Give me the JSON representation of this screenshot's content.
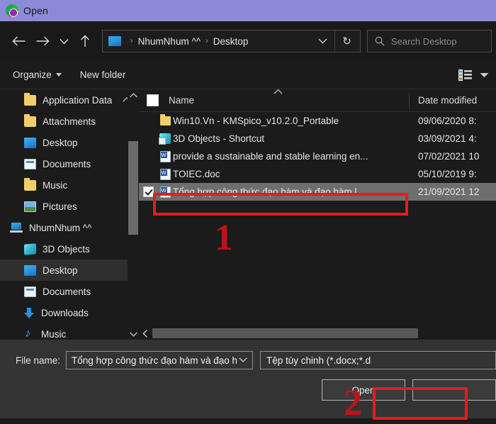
{
  "window": {
    "title": "Open",
    "title_icon": "app-circle-icon"
  },
  "nav": {
    "back_icon": "arrow-left-icon",
    "forward_icon": "arrow-right-icon",
    "recent_icon": "chevron-down-icon",
    "up_icon": "arrow-up-icon",
    "address_icon": "desktop-icon",
    "breadcrumbs": [
      "NhumNhum ^^",
      "Desktop"
    ],
    "separator": "›",
    "dropdown_icon": "chevron-down-icon",
    "refresh_icon": "refresh-icon",
    "refresh_glyph": "↻",
    "search": {
      "icon": "search-icon",
      "placeholder": "Search Desktop",
      "value": ""
    }
  },
  "command_bar": {
    "organize_label": "Organize",
    "organize_caret_icon": "caret-down-icon",
    "new_folder_label": "New folder",
    "view_icon": "list-view-icon",
    "view_caret_icon": "caret-down-icon",
    "help_icon": "help-icon"
  },
  "sidebar": {
    "scroll_up_icon": "chevron-up-icon",
    "scroll_down_icon": "chevron-down-icon",
    "items": [
      {
        "label": "Application Data",
        "icon": "folder-icon",
        "indent": 1,
        "selected": false,
        "trailing_icon": "chevron-up-icon"
      },
      {
        "label": "Attachments",
        "icon": "folder-icon",
        "indent": 1,
        "selected": false
      },
      {
        "label": "Desktop",
        "icon": "desktop-icon",
        "indent": 1,
        "selected": false
      },
      {
        "label": "Documents",
        "icon": "documents-icon",
        "indent": 1,
        "selected": false
      },
      {
        "label": "Music",
        "icon": "folder-icon",
        "indent": 1,
        "selected": false
      },
      {
        "label": "Pictures",
        "icon": "pictures-icon",
        "indent": 1,
        "selected": false
      },
      {
        "label": "NhumNhum ^^",
        "icon": "this-pc-icon",
        "indent": 0,
        "selected": false
      },
      {
        "label": "3D Objects",
        "icon": "cube-icon",
        "indent": 1,
        "selected": false
      },
      {
        "label": "Desktop",
        "icon": "desktop-icon",
        "indent": 1,
        "selected": true
      },
      {
        "label": "Documents",
        "icon": "documents-icon",
        "indent": 1,
        "selected": false
      },
      {
        "label": "Downloads",
        "icon": "download-icon",
        "indent": 1,
        "selected": false
      },
      {
        "label": "Music",
        "icon": "music-icon",
        "indent": 1,
        "selected": false
      }
    ]
  },
  "file_list": {
    "columns": {
      "select_all_icon": "checkbox-icon",
      "name": "Name",
      "sort_caret_icon": "caret-up-icon",
      "date_modified": "Date modified"
    },
    "rows": [
      {
        "name": "Win10.Vn - KMSpico_v10.2.0_Portable",
        "date": "09/06/2020 8:",
        "icon": "folder-icon",
        "checked": false,
        "selected": false
      },
      {
        "name": "3D Objects - Shortcut",
        "date": "03/09/2021 4:",
        "icon": "shortcut-3d-icon",
        "checked": false,
        "selected": false
      },
      {
        "name": "provide a sustainable and stable learning en...",
        "date": "07/02/2021 10",
        "icon": "word-document-icon",
        "checked": false,
        "selected": false
      },
      {
        "name": "TOIEC.doc",
        "date": "05/10/2019 9:",
        "icon": "word-document-icon",
        "checked": false,
        "selected": false
      },
      {
        "name": "Tổng hợp công thức đạo hàm và đạo hàm l...",
        "date": "21/09/2021 12",
        "icon": "word-document-icon",
        "checked": true,
        "selected": true
      }
    ],
    "hscroll_left_icon": "chevron-left-icon"
  },
  "footer": {
    "file_name_label": "File name:",
    "file_name_value": "Tổng hợp công thức đạo hàm và đạo h",
    "file_name_caret_icon": "chevron-down-icon",
    "file_type_value": "Tệp tùy chinh (*.docx;*.d",
    "open_button": "Open",
    "cancel_button": ""
  },
  "annotations": {
    "step1": "1",
    "step2": "2",
    "highlight_color": "#e01d20"
  }
}
